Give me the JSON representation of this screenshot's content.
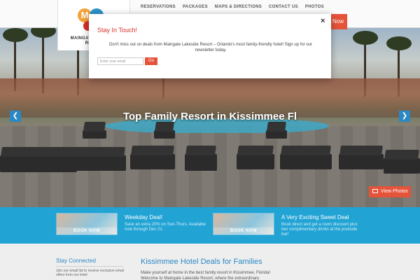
{
  "brand": {
    "logo_letter": "M",
    "logo_text": "MAINGATE LAKESIDE RESORT"
  },
  "nav": {
    "items": [
      {
        "label": "RESERVATIONS"
      },
      {
        "label": "PACKAGES"
      },
      {
        "label": "MAPS & DIRECTIONS"
      },
      {
        "label": "CONTACT US"
      },
      {
        "label": "PHOTOS"
      }
    ],
    "book_now_label": "Now"
  },
  "hero": {
    "title": "Top Family Resort in Kissimmee Fl",
    "prev_icon": "chevron-left-icon",
    "next_icon": "chevron-right-icon",
    "view_photos_label": "View Photos"
  },
  "deals": [
    {
      "title": "Weekday Deal!",
      "description": "Save an extra 20% on Sun-Thurs. Available now through Dec 21.",
      "button_label": "BOOK NOW"
    },
    {
      "title": "A Very Exciting Sweet Deal",
      "description": "Book direct and get a room discount plus two complimentary drinks at the poolside bar!",
      "button_label": "BOOK NOW"
    }
  ],
  "sidebar": {
    "title": "Stay Connected",
    "description": "Join our email list to receive exclusive email offers from our hotel"
  },
  "main": {
    "title": "Kissimmee Hotel Deals for Families",
    "description": "Make yourself at home in the best family resort in Kissimmee, Florida! Welcome to Maingate Lakeside Resort, where the extraordinary"
  },
  "modal": {
    "title": "Stay In Touch!",
    "close_symbol": "×",
    "text": "Don't miss out on deals from Maingate Lakeside Resort – Orlando's most family-friendly hotel! Sign up for our newsletter today.",
    "email_placeholder": "Enter your email",
    "go_label": "Go"
  },
  "colors": {
    "accent_red": "#e4533a",
    "brand_blue": "#2a88c5",
    "deals_band": "#21a3d4"
  }
}
